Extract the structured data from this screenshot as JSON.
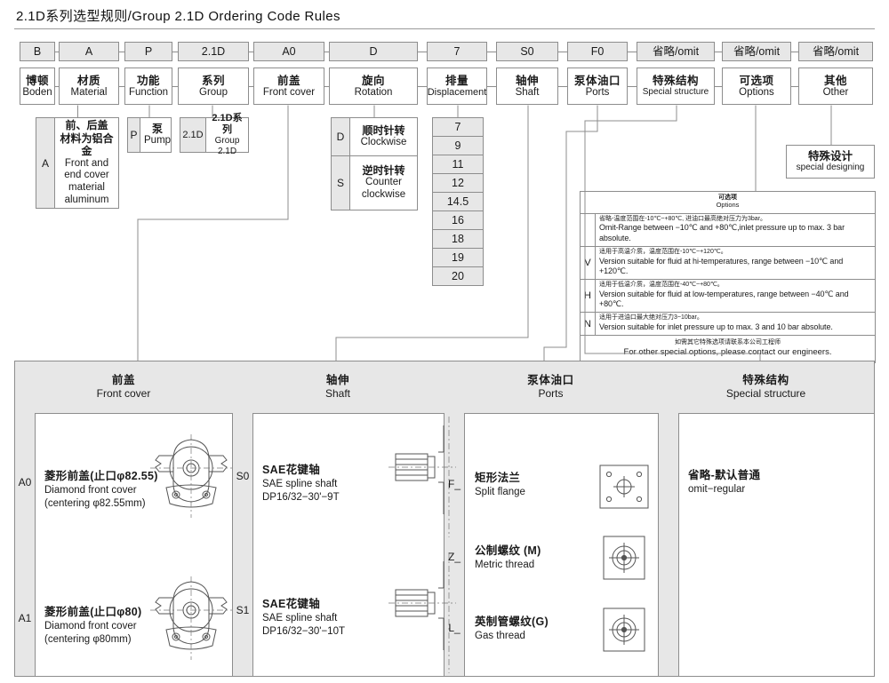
{
  "title": "2.1D系列选型规则/Group  2.1D  Ordering  Code  Rules",
  "code_row": [
    {
      "code": "B",
      "cn": "博顿",
      "en": "Boden"
    },
    {
      "code": "A",
      "cn": "材质",
      "en": "Material"
    },
    {
      "code": "P",
      "cn": "功能",
      "en": "Function"
    },
    {
      "code": "2.1D",
      "cn": "系列",
      "en": "Group"
    },
    {
      "code": "A0",
      "cn": "前盖",
      "en": "Front  cover"
    },
    {
      "code": "D",
      "cn": "旋向",
      "en": "Rotation"
    },
    {
      "code": "7",
      "cn": "排量",
      "en": "Displacement"
    },
    {
      "code": "S0",
      "cn": "轴伸",
      "en": "Shaft"
    },
    {
      "code": "F0",
      "cn": "泵体油口",
      "en": "Ports"
    },
    {
      "code": "省略/omit",
      "cn": "特殊结构",
      "en": "Special  structure"
    },
    {
      "code": "省略/omit",
      "cn": "可选项",
      "en": "Options"
    },
    {
      "code": "省略/omit",
      "cn": "其他",
      "en": "Other"
    }
  ],
  "material_detail": {
    "key": "A",
    "cn1": "前、后盖",
    "cn2": "材料为铝合金",
    "en1": "Front  and",
    "en2": "end  cover",
    "en3": "material",
    "en4": "aluminum"
  },
  "function_detail": {
    "key": "P",
    "cn": "泵",
    "en": "Pump"
  },
  "group_detail": {
    "key": "2.1D",
    "cn": "2.1D系列",
    "en": "Group  2.1D"
  },
  "rotation_detail": [
    {
      "key": "D",
      "cn": "顺时针转",
      "en": "Clockwise",
      "en2": ""
    },
    {
      "key": "S",
      "cn": "逆时针转",
      "en": "Counter",
      "en2": "clockwise"
    }
  ],
  "displacement_values": [
    "7",
    "9",
    "11",
    "12",
    "14.5",
    "16",
    "18",
    "19",
    "20"
  ],
  "special_designing": {
    "cn": "特殊设计",
    "en": "special  designing"
  },
  "options_table": {
    "head_cn": "可选项",
    "head_en": "Options",
    "rows": [
      {
        "key": "",
        "cn": "省略-温度范围在-10℃~+80℃, 进油口最高绝对压力为3bar。",
        "en": "Omit-Range  between  −10℃  and  +80℃,inlet  pressure  up  to  max.  3  bar  absolute."
      },
      {
        "key": "V",
        "cn": "适用于高温介质，温度范围在-10℃~+120℃。",
        "en": "Version  suitable  for  fluid  at  hi-temperatures,  range  between  −10℃  and  +120℃."
      },
      {
        "key": "H",
        "cn": "适用于低温介质，温度范围在-40℃~+80℃。",
        "en": "Version  suitable  for  fluid  at  low-temperatures,  range  between  −40℃  and  +80℃."
      },
      {
        "key": "N",
        "cn": "适用于进油口最大绝对压力3~10bar。",
        "en": "Version  suitable  for  inlet  pressure  up  to  max.  3  and  10  bar  absolute."
      }
    ],
    "footer_cn": "如需其它特殊选项请联系本公司工程师",
    "footer_en": "For  other  special  options,  please  contact  our  engineers."
  },
  "bottom_sections": [
    {
      "cn": "前盖",
      "en": "Front  cover"
    },
    {
      "cn": "轴伸",
      "en": "Shaft"
    },
    {
      "cn": "泵体油口",
      "en": "Ports"
    },
    {
      "cn": "特殊结构",
      "en": "Special  structure"
    }
  ],
  "front_cover_items": [
    {
      "key": "A0",
      "cn": "菱形前盖(止口φ82.55)",
      "en": "Diamond  front  cover",
      "sub": "(centering  φ82.55mm)"
    },
    {
      "key": "A1",
      "cn": "菱形前盖(止口φ80)",
      "en": "Diamond  front  cover",
      "sub": "(centering  φ80mm)"
    }
  ],
  "shaft_items": [
    {
      "key": "S0",
      "cn": "SAE花键轴",
      "en": "SAE  spline  shaft",
      "sub": "DP16/32−30'−9T"
    },
    {
      "key": "S1",
      "cn": "SAE花键轴",
      "en": "SAE  spline  shaft",
      "sub": "DP16/32−30'−10T"
    }
  ],
  "ports_items": [
    {
      "key": "F_",
      "cn": "矩形法兰",
      "en": "Split  flange",
      "icon": "split-flange-icon"
    },
    {
      "key": "Z_",
      "cn": "公制螺纹 (M)",
      "en": "Metric  thread",
      "icon": "metric-thread-icon"
    },
    {
      "key": "L_",
      "cn": "英制管螺纹(G)",
      "en": "Gas  thread",
      "icon": "gas-thread-icon"
    }
  ],
  "special_structure_items": [
    {
      "cn": "省略-默认普通",
      "en": "omit−regular"
    }
  ],
  "colors": {
    "line": "#8d8d8d",
    "shade": "#e7e7e7",
    "text": "#1a1a1a",
    "background": "#ffffff"
  }
}
